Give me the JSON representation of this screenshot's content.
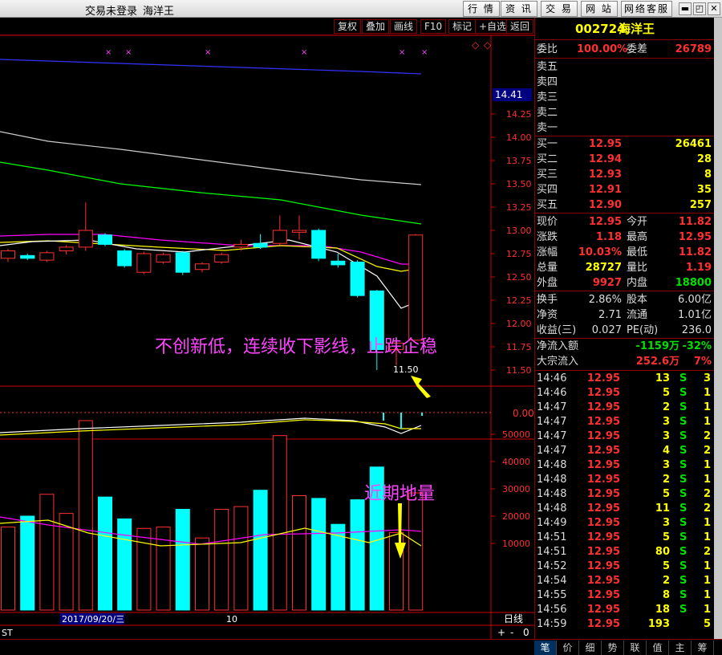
{
  "window": {
    "login": "交易未登录",
    "app_name": "海洋王",
    "menu": [
      "行 情",
      "资 讯",
      "交 易",
      "网 站",
      "网络客服"
    ],
    "controls": [
      "▬",
      "◰",
      "✕"
    ]
  },
  "chart_toolbar": [
    "复权",
    "叠加",
    "画线",
    "F10",
    "标记",
    "+自选",
    "返回"
  ],
  "price_axis": {
    "current": "14.41",
    "ticks": [
      "14.25",
      "14.00",
      "13.75",
      "13.50",
      "13.25",
      "13.00",
      "12.75",
      "12.50",
      "12.25",
      "12.00",
      "11.75",
      "11.50"
    ]
  },
  "low_marker": "11.50",
  "annotation_main": "不创新低，连续收下影线，止跌企稳",
  "annotation_volume": "近期地量",
  "macd_axis": "0.00",
  "volume_axis": [
    "50000",
    "40000",
    "30000",
    "20000",
    "10000"
  ],
  "date_label": "2017/09/20/三",
  "month_label": "10",
  "period_label": "日线",
  "bottom_left": "ST",
  "zoom_controls": [
    "+",
    "-",
    "0"
  ],
  "chart_data": {
    "type": "candlestick",
    "candles": [
      {
        "o": 12.7,
        "c": 12.78,
        "h": 12.8,
        "l": 12.66
      },
      {
        "o": 12.73,
        "c": 12.7,
        "h": 12.75,
        "l": 12.68
      },
      {
        "o": 12.68,
        "c": 12.76,
        "h": 12.78,
        "l": 12.66
      },
      {
        "o": 12.78,
        "c": 12.82,
        "h": 12.84,
        "l": 12.74
      },
      {
        "o": 12.82,
        "c": 13.0,
        "h": 13.3,
        "l": 12.78
      },
      {
        "o": 12.95,
        "c": 12.85,
        "h": 12.97,
        "l": 12.83
      },
      {
        "o": 12.78,
        "c": 12.62,
        "h": 12.8,
        "l": 12.6
      },
      {
        "o": 12.55,
        "c": 12.75,
        "h": 12.77,
        "l": 12.53
      },
      {
        "o": 12.66,
        "c": 12.74,
        "h": 12.76,
        "l": 12.64
      },
      {
        "o": 12.76,
        "c": 12.55,
        "h": 12.78,
        "l": 12.52
      },
      {
        "o": 12.58,
        "c": 12.64,
        "h": 12.66,
        "l": 12.55
      },
      {
        "o": 12.66,
        "c": 12.74,
        "h": 12.76,
        "l": 12.64
      },
      {
        "o": 12.82,
        "c": 12.85,
        "h": 12.9,
        "l": 12.78
      },
      {
        "o": 12.86,
        "c": 12.82,
        "h": 12.96,
        "l": 12.8
      },
      {
        "o": 12.86,
        "c": 13.0,
        "h": 13.16,
        "l": 12.84
      },
      {
        "o": 12.98,
        "c": 13.0,
        "h": 13.16,
        "l": 12.9
      },
      {
        "o": 13.0,
        "c": 12.7,
        "h": 13.02,
        "l": 12.67
      },
      {
        "o": 12.67,
        "c": 12.63,
        "h": 12.75,
        "l": 12.6
      },
      {
        "o": 12.66,
        "c": 12.3,
        "h": 12.68,
        "l": 12.28
      },
      {
        "o": 12.35,
        "c": 11.72,
        "h": 12.36,
        "l": 11.5
      },
      {
        "o": 11.72,
        "c": 11.79,
        "h": 11.8,
        "l": 11.55
      },
      {
        "o": 11.82,
        "c": 12.95,
        "h": 12.96,
        "l": 11.82
      }
    ],
    "volume": [
      16000,
      20000,
      28000,
      21000,
      55000,
      27000,
      19000,
      15500,
      16000,
      22500,
      12000,
      22500,
      23500,
      29500,
      49500,
      27500,
      26500,
      17000,
      26000,
      38000,
      14000,
      28500
    ]
  },
  "quote": {
    "code": "002724",
    "name": "海洋王",
    "weibi_label": "委比",
    "weibi": "100.00%",
    "weicha_label": "委差",
    "weicha": "26789",
    "sell": [
      {
        "label": "卖五"
      },
      {
        "label": "卖四"
      },
      {
        "label": "卖三"
      },
      {
        "label": "卖二"
      },
      {
        "label": "卖一"
      }
    ],
    "buy": [
      {
        "label": "买一",
        "price": "12.95",
        "vol": "26461"
      },
      {
        "label": "买二",
        "price": "12.94",
        "vol": "28"
      },
      {
        "label": "买三",
        "price": "12.93",
        "vol": "8"
      },
      {
        "label": "买四",
        "price": "12.91",
        "vol": "35"
      },
      {
        "label": "买五",
        "price": "12.90",
        "vol": "257"
      }
    ],
    "stats": [
      {
        "l1": "现价",
        "v1": "12.95",
        "l2": "今开",
        "v2": "11.82"
      },
      {
        "l1": "涨跌",
        "v1": "1.18",
        "l2": "最高",
        "v2": "12.95"
      },
      {
        "l1": "涨幅",
        "v1": "10.03%",
        "l2": "最低",
        "v2": "11.82"
      },
      {
        "l1": "总量",
        "v1": "28727",
        "l2": "量比",
        "v2": "1.19"
      },
      {
        "l1": "外盘",
        "v1": "9927",
        "l2": "内盘",
        "v2": "18800"
      }
    ],
    "fin": [
      {
        "l1": "换手",
        "v1": "2.86%",
        "l2": "股本",
        "v2": "6.00亿"
      },
      {
        "l1": "净资",
        "v1": "2.71",
        "l2": "流通",
        "v2": "1.01亿"
      },
      {
        "l1": "收益(三)",
        "v1": "0.027",
        "l2": "PE(动)",
        "v2": "236.0"
      }
    ],
    "flow": [
      {
        "label": "净流入额",
        "v1": "-1159万",
        "v2": "-32%"
      },
      {
        "label": "大宗流入",
        "v1": "252.6万",
        "v2": "7%"
      }
    ],
    "ticks": [
      [
        "14:46",
        "12.95",
        "13",
        "S",
        "3"
      ],
      [
        "14:46",
        "12.95",
        "5",
        "S",
        "1"
      ],
      [
        "14:47",
        "12.95",
        "2",
        "S",
        "1"
      ],
      [
        "14:47",
        "12.95",
        "3",
        "S",
        "1"
      ],
      [
        "14:47",
        "12.95",
        "3",
        "S",
        "2"
      ],
      [
        "14:47",
        "12.95",
        "4",
        "S",
        "2"
      ],
      [
        "14:48",
        "12.95",
        "3",
        "S",
        "1"
      ],
      [
        "14:48",
        "12.95",
        "2",
        "S",
        "1"
      ],
      [
        "14:48",
        "12.95",
        "5",
        "S",
        "2"
      ],
      [
        "14:48",
        "12.95",
        "11",
        "S",
        "2"
      ],
      [
        "14:49",
        "12.95",
        "3",
        "S",
        "1"
      ],
      [
        "14:51",
        "12.95",
        "5",
        "S",
        "1"
      ],
      [
        "14:51",
        "12.95",
        "80",
        "S",
        "2"
      ],
      [
        "14:52",
        "12.95",
        "5",
        "S",
        "1"
      ],
      [
        "14:54",
        "12.95",
        "2",
        "S",
        "1"
      ],
      [
        "14:55",
        "12.95",
        "8",
        "S",
        "1"
      ],
      [
        "14:56",
        "12.95",
        "18",
        "S",
        "1"
      ],
      [
        "14:59",
        "12.95",
        "193",
        "",
        "5"
      ]
    ]
  },
  "bottom_tabs": [
    "笔",
    "价",
    "细",
    "势",
    "联",
    "值",
    "主",
    "筹"
  ],
  "colors": {
    "up": "#ff3030",
    "down": "#00ffff",
    "axis": "#cc0000",
    "ma5": "#ffffff",
    "ma10": "#ffff00",
    "ma20": "#ff00ff",
    "ma60": "#00ff00",
    "ma120": "#cccccc",
    "ma250": "#3333ff"
  }
}
